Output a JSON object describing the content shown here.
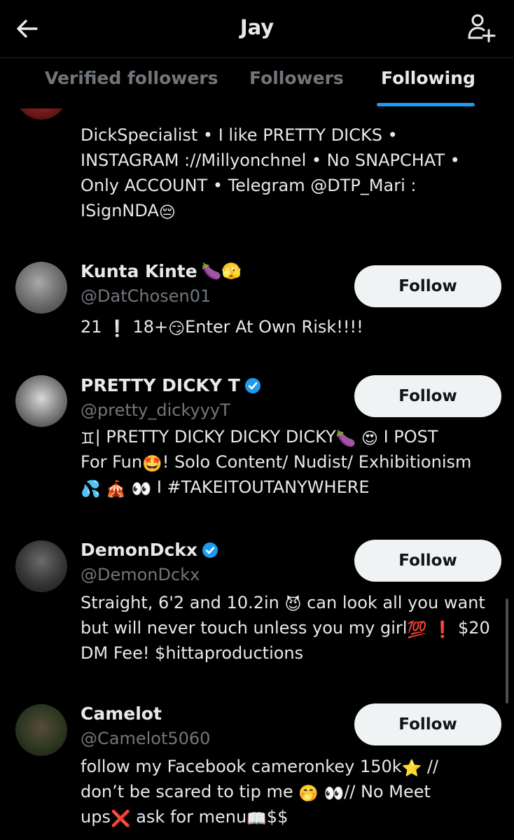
{
  "header": {
    "title": "Jay",
    "back_icon": "arrow-left-icon",
    "add_icon": "person-add-icon"
  },
  "tabs": [
    {
      "label": "Verified followers",
      "active": false
    },
    {
      "label": "Followers",
      "active": false
    },
    {
      "label": "Following",
      "active": true
    }
  ],
  "accent_color": "#1d9bf0",
  "accounts": [
    {
      "bio": [
        "DickSpecialist • I like PRETTY DICKS •",
        "INSTAGRAM ://Millyonchnel • No SNAPCHAT •",
        "Only ACCOUNT • Telegram @DTP_Mari :",
        "ISignNDA"
      ],
      "bio_emoji": "😔"
    },
    {
      "name": "Kunta Kinte",
      "name_emoji": "🍆🫣",
      "handle": "@DatChosen01",
      "bio_parts": [
        "21 ",
        "❕",
        " 18+",
        "😏",
        "Enter At Own Risk!!!!"
      ],
      "button": "Follow"
    },
    {
      "name": "PRETTY DICKY T",
      "verified": true,
      "handle": "@pretty_dickyyyT",
      "bio_line1_parts": [
        "♊",
        "| PRETTY DICKY DICKY DICKY",
        "🍆",
        " ",
        "😍",
        " I POST"
      ],
      "bio_line2_parts": [
        "For Fun",
        "🤩",
        "! Solo Content/ Nudist/ Exhibitionism"
      ],
      "bio_line3_parts": [
        "💦",
        " ",
        "🎪",
        " ",
        "👀",
        " I #TAKEITOUTANYWHERE"
      ],
      "button": "Follow"
    },
    {
      "name": "DemonDckx",
      "verified": true,
      "handle": "@DemonDckx",
      "bio_line1_parts": [
        "Straight, 6'2 and 10.2in ",
        "😈",
        " can look all you want"
      ],
      "bio_line2_parts": [
        "but will never touch unless you my girl",
        "💯",
        " ",
        "❗",
        " $20"
      ],
      "bio_line3": "DM Fee! $hittaproductions",
      "button": "Follow"
    },
    {
      "name": "Camelot",
      "handle": "@Camelot5060",
      "bio_line1_parts": [
        "follow my Facebook cameronkey 150k",
        "⭐",
        " //"
      ],
      "bio_line2_parts": [
        "don’t be scared to tip me ",
        "🤭",
        " ",
        "👀",
        "// No Meet"
      ],
      "bio_line3_parts": [
        "ups",
        "❌",
        " ask for menu",
        "📖",
        "$$"
      ],
      "button": "Follow"
    }
  ]
}
